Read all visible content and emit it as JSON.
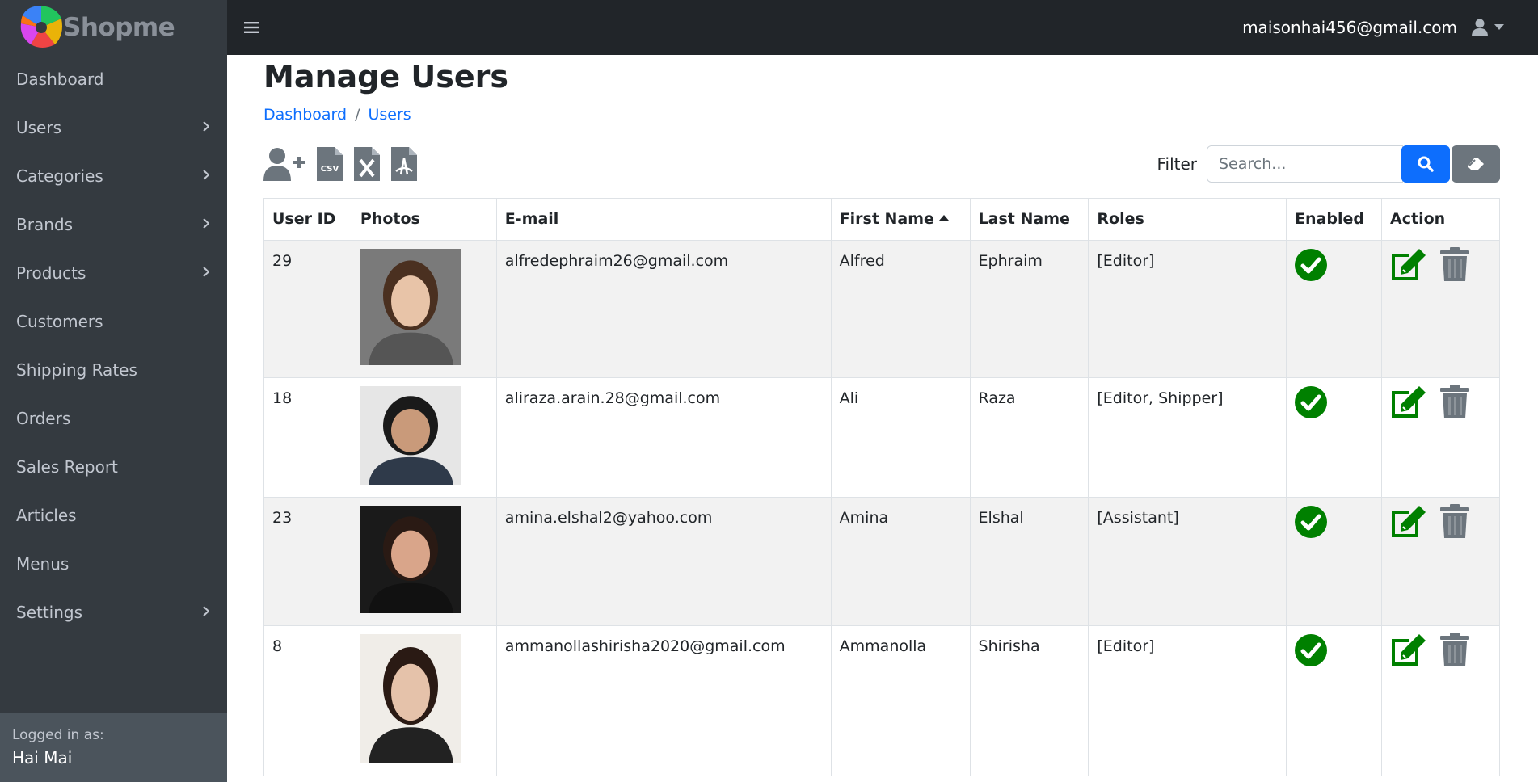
{
  "brand": {
    "name": "Shopme"
  },
  "sidebar": {
    "items": [
      {
        "label": "Dashboard",
        "has_children": false
      },
      {
        "label": "Users",
        "has_children": true
      },
      {
        "label": "Categories",
        "has_children": true
      },
      {
        "label": "Brands",
        "has_children": true
      },
      {
        "label": "Products",
        "has_children": true
      },
      {
        "label": "Customers",
        "has_children": false
      },
      {
        "label": "Shipping Rates",
        "has_children": false
      },
      {
        "label": "Orders",
        "has_children": false
      },
      {
        "label": "Sales Report",
        "has_children": false
      },
      {
        "label": "Articles",
        "has_children": false
      },
      {
        "label": "Menus",
        "has_children": false
      },
      {
        "label": "Settings",
        "has_children": true
      }
    ],
    "footer": {
      "label": "Logged in as:",
      "name": "Hai Mai"
    }
  },
  "topbar": {
    "email": "maisonhai456@gmail.com"
  },
  "page": {
    "title": "Manage Users",
    "breadcrumb": {
      "home": "Dashboard",
      "current": "Users",
      "separator": "/"
    }
  },
  "toolbar": {
    "icons": [
      "add-user-icon",
      "csv-file-icon",
      "excel-file-icon",
      "pdf-file-icon"
    ],
    "filter_label": "Filter",
    "search_placeholder": "Search..."
  },
  "table": {
    "headers": {
      "id": "User ID",
      "photos": "Photos",
      "email": "E-mail",
      "first": "First Name",
      "last": "Last Name",
      "roles": "Roles",
      "enabled": "Enabled",
      "action": "Action"
    },
    "sorted_by": "First Name",
    "rows": [
      {
        "id": "29",
        "email": "alfredephraim26@gmail.com",
        "first": "Alfred",
        "last": "Ephraim",
        "roles": "[Editor]",
        "enabled": true
      },
      {
        "id": "18",
        "email": "aliraza.arain.28@gmail.com",
        "first": "Ali",
        "last": "Raza",
        "roles": "[Editor, Shipper]",
        "enabled": true
      },
      {
        "id": "23",
        "email": "amina.elshal2@yahoo.com",
        "first": "Amina",
        "last": "Elshal",
        "roles": "[Assistant]",
        "enabled": true
      },
      {
        "id": "8",
        "email": "ammanollashirisha2020@gmail.com",
        "first": "Ammanolla",
        "last": "Shirisha",
        "roles": "[Editor]",
        "enabled": true
      }
    ]
  },
  "colors": {
    "sidebar_bg": "#343a40",
    "topbar_bg": "#212529",
    "primary": "#0d6efd",
    "secondary": "#6c757d",
    "success": "#008000",
    "link": "#0d6efd"
  }
}
